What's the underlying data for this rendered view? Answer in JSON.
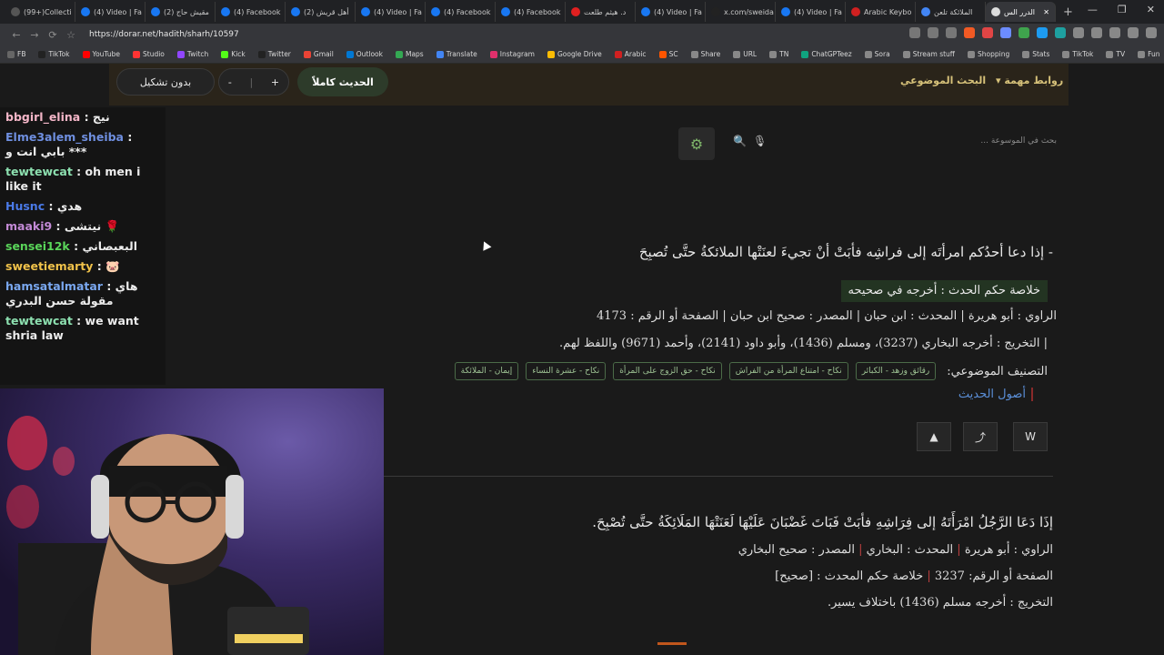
{
  "browser": {
    "tabs": [
      {
        "title": "(99+)Collecti",
        "color": "#555"
      },
      {
        "title": "(4) Video | Fa",
        "color": "#1877f2"
      },
      {
        "title": "(2) مقيش حاج",
        "color": "#1877f2"
      },
      {
        "title": "(4) Facebook",
        "color": "#1877f2"
      },
      {
        "title": "(2) أهل قريش",
        "color": "#1877f2"
      },
      {
        "title": "(4) Video | Fa",
        "color": "#1877f2"
      },
      {
        "title": "(4) Facebook",
        "color": "#1877f2"
      },
      {
        "title": "(4) Facebook",
        "color": "#1877f2"
      },
      {
        "title": "د. هيثم طلعت",
        "color": "#e02020"
      },
      {
        "title": "(4) Video | Fa",
        "color": "#1877f2"
      },
      {
        "title": "x.com/sweida",
        "color": "#222"
      },
      {
        "title": "(4) Video | Fa",
        "color": "#1877f2"
      },
      {
        "title": "Arabic Keybo",
        "color": "#d02020"
      },
      {
        "title": "الملائكة تلعن",
        "color": "#4285f4"
      },
      {
        "title": "الدرر الس",
        "color": "#ddd",
        "active": true
      }
    ],
    "new_tab": "+",
    "window_controls": [
      "—",
      "❐",
      "✕"
    ],
    "url": "https://dorar.net/hadith/sharh/10597",
    "nav": {
      "back": "←",
      "forward": "→",
      "reload": "⟳",
      "bookmark": "☆"
    },
    "bookmarks": [
      {
        "label": "FB",
        "color": "#666"
      },
      {
        "label": "TikTok",
        "color": "#222"
      },
      {
        "label": "YouTube",
        "color": "#ff0000"
      },
      {
        "label": "Studio",
        "color": "#ff3333"
      },
      {
        "label": "Twitch",
        "color": "#9146ff"
      },
      {
        "label": "Kick",
        "color": "#53fc18"
      },
      {
        "label": "Twitter",
        "color": "#222"
      },
      {
        "label": "Gmail",
        "color": "#ea4335"
      },
      {
        "label": "Outlook",
        "color": "#0078d4"
      },
      {
        "label": "Maps",
        "color": "#34a853"
      },
      {
        "label": "Translate",
        "color": "#4285f4"
      },
      {
        "label": "Instagram",
        "color": "#e1306c"
      },
      {
        "label": "Google Drive",
        "color": "#fbbc04"
      },
      {
        "label": "Arabic",
        "color": "#d02020"
      },
      {
        "label": "SC",
        "color": "#ff5500"
      },
      {
        "label": "Share",
        "color": "#888"
      },
      {
        "label": "URL",
        "color": "#888"
      },
      {
        "label": "TN",
        "color": "#888"
      },
      {
        "label": "ChatGPTeez",
        "color": "#10a37f"
      },
      {
        "label": "Sora",
        "color": "#888"
      },
      {
        "label": "Stream stuff",
        "color": "#888"
      },
      {
        "label": "Shopping",
        "color": "#888"
      },
      {
        "label": "Stats",
        "color": "#888"
      },
      {
        "label": "TikTok",
        "color": "#888"
      },
      {
        "label": "TV",
        "color": "#888"
      },
      {
        "label": "Fun",
        "color": "#888"
      }
    ]
  },
  "site": {
    "top": {
      "no_diacritics": "بدون تشكيل",
      "minus": "-",
      "plus": "+",
      "full_hadith": "الحديث كاملاً",
      "topic_search": "البحث الموضوعي",
      "important_links": "روابط مهمة"
    },
    "search": {
      "placeholder": "بحث في الموسوعة ...",
      "gear": "⚙",
      "search_icon": "🔍",
      "mic_icon": "🎙"
    },
    "hadith1": {
      "text": "- إذا دعا أحدُكم امرأتَه إلى فراشِه فأبَتْ أنْ تجيءَ لعنَتْها الملائكةُ حتَّى تُصبِحَ",
      "verdict": "خلاصة حكم الحدث : أخرجه في صحيحه",
      "meta": "الراوي : أبو هريرة | المحدث : ابن حبان | المصدر : صحيح ابن حبان | الصفحة أو الرقم : 4173",
      "takhrij": "| التخريج : أخرجه البخاري (3237)، ومسلم (1436)، وأبو داود (2141)، وأحمد (9671) واللفظ لهم.",
      "cat_label": "التصنيف الموضوعي:",
      "categories": [
        "رقائق وزهد - الكبائر",
        "نكاح - امتناع المرأة من الفراش",
        "نكاح - حق الزوج على المرأة",
        "نكاح - عشرة النساء",
        "إيمان - الملائكة"
      ],
      "usul": "أصول الحديث"
    },
    "actions": {
      "report": "▲",
      "share": "⤴",
      "word": "W"
    },
    "hadith2": {
      "text": "إذَا دَعَا الرَّجُلُ امْرَأَتَهُ إلى فِرَاشِهِ فأبَتْ فَبَاتَ غَضْبَانَ عَلَيْهَا لَعَنَتْهَا المَلَائِكَةُ حتَّى تُصْبِحَ.",
      "m1_a": "الراوي : أبو هريرة",
      "m1_b": "المحدث : البخاري",
      "m1_c": "المصدر : صحيح البخاري",
      "m2_a": "الصفحة أو الرقم: 3237",
      "m2_b": "خلاصة حكم المحدث : [صحيح]",
      "m3": "التخريج : أخرجه مسلم (1436) باختلاف يسير."
    }
  },
  "chat": {
    "messages": [
      {
        "user": "bbgirl_elina",
        "color": "#f4b6c8",
        "text": "نيج"
      },
      {
        "user": "Elme3alem_sheiba",
        "color": "#6f8fe0",
        "text": "بابي انت و ***"
      },
      {
        "user": "tewtewcat",
        "color": "#8de0b0",
        "text": "oh men i like it"
      },
      {
        "user": "Husnc",
        "color": "#4a7ae8",
        "text": "هدي"
      },
      {
        "user": "maaki9",
        "color": "#c38ad6",
        "text": "نيتشى 🌹"
      },
      {
        "user": "sensei12k",
        "color": "#5ad65a",
        "text": "البعبصاني"
      },
      {
        "user": "sweetiemarty",
        "color": "#f0c24a",
        "text": "🐷"
      },
      {
        "user": "hamsatalmatar",
        "color": "#7aa8f0",
        "text": "هاي مقولة حسن البدري"
      },
      {
        "user": "tewtewcat",
        "color": "#8de0b0",
        "text": "we want shria law"
      }
    ]
  }
}
